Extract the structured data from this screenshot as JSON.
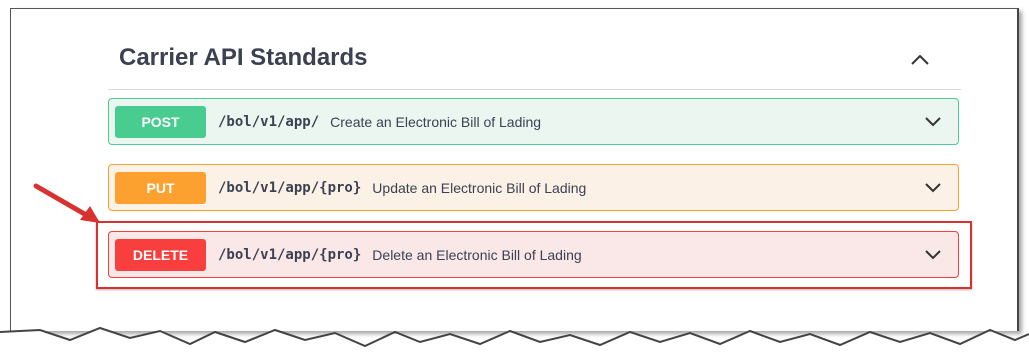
{
  "section": {
    "title": "Carrier API Standards"
  },
  "operations": [
    {
      "method": "POST",
      "path": "/bol/v1/app/",
      "summary": "Create an Electronic Bill of Lading"
    },
    {
      "method": "PUT",
      "path": "/bol/v1/app/{pro}",
      "summary": "Update an Electronic Bill of Lading"
    },
    {
      "method": "DELETE",
      "path": "/bol/v1/app/{pro}",
      "summary": "Delete an Electronic Bill of Lading"
    }
  ],
  "icons": {
    "collapse": "chevron-up-icon",
    "expand": "chevron-down-icon",
    "pointer": "red-arrow"
  },
  "colors": {
    "post": "#49cc90",
    "put": "#fca130",
    "delete": "#f93e3e",
    "highlight": "#d9312f"
  }
}
